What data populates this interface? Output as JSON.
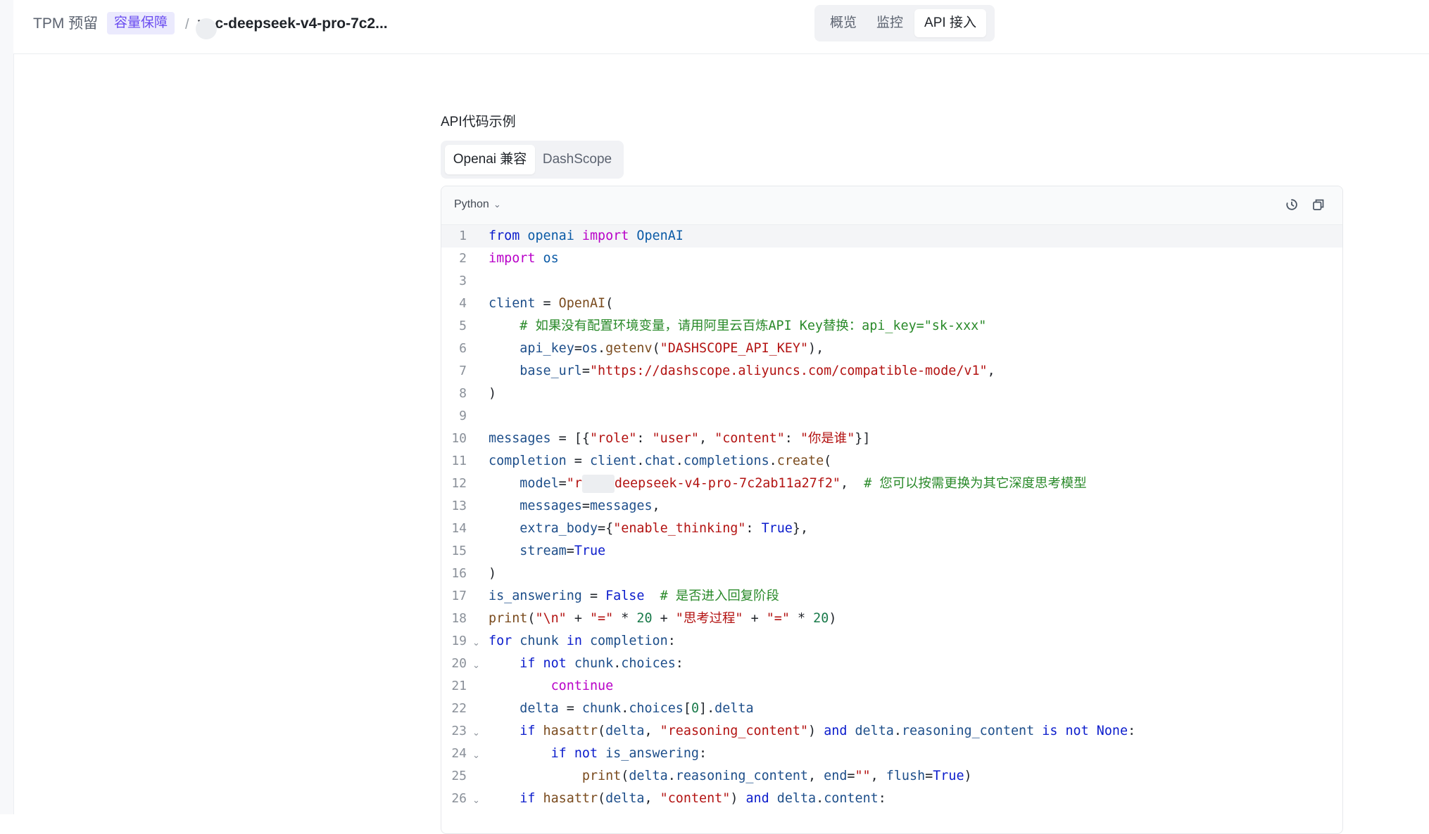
{
  "header": {
    "brand": "TPM 预留",
    "tag": "容量保障",
    "separator": "/",
    "breadcrumb": "v -c-deepseek-v4-pro-7c2...",
    "tabs": [
      {
        "label": "概览",
        "active": false
      },
      {
        "label": "监控",
        "active": false
      },
      {
        "label": "API 接入",
        "active": true
      }
    ]
  },
  "main": {
    "section_title": "API代码示例",
    "sdk_tabs": [
      {
        "label": "Openai 兼容",
        "active": true
      },
      {
        "label": "DashScope",
        "active": false
      }
    ],
    "code": {
      "language": "Python",
      "icons": [
        "history-icon",
        "copy-icon"
      ],
      "highlighted_line": 1,
      "lines": [
        {
          "n": "1",
          "fold": "",
          "tokens": [
            [
              "kw",
              "from"
            ],
            [
              "pl",
              " "
            ],
            [
              "cls",
              "openai"
            ],
            [
              "pl",
              " "
            ],
            [
              "imp",
              "import"
            ],
            [
              "pl",
              " "
            ],
            [
              "cls",
              "OpenAI"
            ]
          ]
        },
        {
          "n": "2",
          "fold": "",
          "tokens": [
            [
              "imp",
              "import"
            ],
            [
              "pl",
              " "
            ],
            [
              "cls",
              "os"
            ]
          ]
        },
        {
          "n": "3",
          "fold": "",
          "tokens": []
        },
        {
          "n": "4",
          "fold": "",
          "tokens": [
            [
              "id",
              "client"
            ],
            [
              "pl",
              " = "
            ],
            [
              "fn",
              "OpenAI"
            ],
            [
              "pl",
              "("
            ]
          ]
        },
        {
          "n": "5",
          "fold": "",
          "tokens": [
            [
              "pl",
              "    "
            ],
            [
              "cm",
              "# 如果没有配置环境变量，请用阿里云百炼API Key替换：api_key=\"sk-xxx\""
            ]
          ]
        },
        {
          "n": "6",
          "fold": "",
          "tokens": [
            [
              "pl",
              "    "
            ],
            [
              "id",
              "api_key"
            ],
            [
              "pl",
              "="
            ],
            [
              "id",
              "os"
            ],
            [
              "pl",
              "."
            ],
            [
              "fn",
              "getenv"
            ],
            [
              "pl",
              "("
            ],
            [
              "str",
              "\"DASHSCOPE_API_KEY\""
            ],
            [
              "pl",
              "),"
            ]
          ]
        },
        {
          "n": "7",
          "fold": "",
          "tokens": [
            [
              "pl",
              "    "
            ],
            [
              "id",
              "base_url"
            ],
            [
              "pl",
              "="
            ],
            [
              "str",
              "\"https://dashscope.aliyuncs.com/compatible-mode/v1\""
            ],
            [
              "pl",
              ","
            ]
          ]
        },
        {
          "n": "8",
          "fold": "",
          "tokens": [
            [
              "pl",
              ")"
            ]
          ]
        },
        {
          "n": "9",
          "fold": "",
          "tokens": []
        },
        {
          "n": "10",
          "fold": "",
          "tokens": [
            [
              "id",
              "messages"
            ],
            [
              "pl",
              " = [{"
            ],
            [
              "str",
              "\"role\""
            ],
            [
              "pl",
              ": "
            ],
            [
              "str",
              "\"user\""
            ],
            [
              "pl",
              ", "
            ],
            [
              "str",
              "\"content\""
            ],
            [
              "pl",
              ": "
            ],
            [
              "str",
              "\"你是谁\""
            ],
            [
              "pl",
              "}]"
            ]
          ]
        },
        {
          "n": "11",
          "fold": "",
          "tokens": [
            [
              "id",
              "completion"
            ],
            [
              "pl",
              " = "
            ],
            [
              "id",
              "client"
            ],
            [
              "pl",
              "."
            ],
            [
              "id",
              "chat"
            ],
            [
              "pl",
              "."
            ],
            [
              "id",
              "completions"
            ],
            [
              "pl",
              "."
            ],
            [
              "fn",
              "create"
            ],
            [
              "pl",
              "("
            ]
          ]
        },
        {
          "n": "12",
          "fold": "",
          "tokens": [
            [
              "pl",
              "    "
            ],
            [
              "id",
              "model"
            ],
            [
              "pl",
              "="
            ],
            [
              "str",
              "\"r"
            ],
            [
              "mask",
              ""
            ],
            [
              "str",
              "deepseek-v4-pro-7c2ab11a27f2\""
            ],
            [
              "pl",
              ",  "
            ],
            [
              "cm",
              "# 您可以按需更换为其它深度思考模型"
            ]
          ]
        },
        {
          "n": "13",
          "fold": "",
          "tokens": [
            [
              "pl",
              "    "
            ],
            [
              "id",
              "messages"
            ],
            [
              "pl",
              "="
            ],
            [
              "id",
              "messages"
            ],
            [
              "pl",
              ","
            ]
          ]
        },
        {
          "n": "14",
          "fold": "",
          "tokens": [
            [
              "pl",
              "    "
            ],
            [
              "id",
              "extra_body"
            ],
            [
              "pl",
              "={"
            ],
            [
              "str",
              "\"enable_thinking\""
            ],
            [
              "pl",
              ": "
            ],
            [
              "kw",
              "True"
            ],
            [
              "pl",
              "},"
            ]
          ]
        },
        {
          "n": "15",
          "fold": "",
          "tokens": [
            [
              "pl",
              "    "
            ],
            [
              "id",
              "stream"
            ],
            [
              "pl",
              "="
            ],
            [
              "kw",
              "True"
            ]
          ]
        },
        {
          "n": "16",
          "fold": "",
          "tokens": [
            [
              "pl",
              ")"
            ]
          ]
        },
        {
          "n": "17",
          "fold": "",
          "tokens": [
            [
              "id",
              "is_answering"
            ],
            [
              "pl",
              " = "
            ],
            [
              "kw",
              "False"
            ],
            [
              "pl",
              "  "
            ],
            [
              "cm",
              "# 是否进入回复阶段"
            ]
          ]
        },
        {
          "n": "18",
          "fold": "",
          "tokens": [
            [
              "fn",
              "print"
            ],
            [
              "pl",
              "("
            ],
            [
              "str",
              "\"\\n\""
            ],
            [
              "pl",
              " + "
            ],
            [
              "str",
              "\"=\""
            ],
            [
              "pl",
              " * "
            ],
            [
              "num",
              "20"
            ],
            [
              "pl",
              " + "
            ],
            [
              "str",
              "\"思考过程\""
            ],
            [
              "pl",
              " + "
            ],
            [
              "str",
              "\"=\""
            ],
            [
              "pl",
              " * "
            ],
            [
              "num",
              "20"
            ],
            [
              "pl",
              ")"
            ]
          ]
        },
        {
          "n": "19",
          "fold": "⌄",
          "tokens": [
            [
              "kw",
              "for"
            ],
            [
              "pl",
              " "
            ],
            [
              "id",
              "chunk"
            ],
            [
              "pl",
              " "
            ],
            [
              "kw",
              "in"
            ],
            [
              "pl",
              " "
            ],
            [
              "id",
              "completion"
            ],
            [
              "pl",
              ":"
            ]
          ]
        },
        {
          "n": "20",
          "fold": "⌄",
          "tokens": [
            [
              "pl",
              "    "
            ],
            [
              "kw",
              "if"
            ],
            [
              "pl",
              " "
            ],
            [
              "kw",
              "not"
            ],
            [
              "pl",
              " "
            ],
            [
              "id",
              "chunk"
            ],
            [
              "pl",
              "."
            ],
            [
              "id",
              "choices"
            ],
            [
              "pl",
              ":"
            ]
          ]
        },
        {
          "n": "21",
          "fold": "",
          "tokens": [
            [
              "pl",
              "        "
            ],
            [
              "imp",
              "continue"
            ]
          ]
        },
        {
          "n": "22",
          "fold": "",
          "tokens": [
            [
              "pl",
              "    "
            ],
            [
              "id",
              "delta"
            ],
            [
              "pl",
              " = "
            ],
            [
              "id",
              "chunk"
            ],
            [
              "pl",
              "."
            ],
            [
              "id",
              "choices"
            ],
            [
              "pl",
              "["
            ],
            [
              "num",
              "0"
            ],
            [
              "pl",
              "]."
            ],
            [
              "id",
              "delta"
            ]
          ]
        },
        {
          "n": "23",
          "fold": "⌄",
          "tokens": [
            [
              "pl",
              "    "
            ],
            [
              "kw",
              "if"
            ],
            [
              "pl",
              " "
            ],
            [
              "fn",
              "hasattr"
            ],
            [
              "pl",
              "("
            ],
            [
              "id",
              "delta"
            ],
            [
              "pl",
              ", "
            ],
            [
              "str",
              "\"reasoning_content\""
            ],
            [
              "pl",
              ") "
            ],
            [
              "kw",
              "and"
            ],
            [
              "pl",
              " "
            ],
            [
              "id",
              "delta"
            ],
            [
              "pl",
              "."
            ],
            [
              "id",
              "reasoning_content"
            ],
            [
              "pl",
              " "
            ],
            [
              "kw",
              "is"
            ],
            [
              "pl",
              " "
            ],
            [
              "kw",
              "not"
            ],
            [
              "pl",
              " "
            ],
            [
              "kw",
              "None"
            ],
            [
              "pl",
              ":"
            ]
          ]
        },
        {
          "n": "24",
          "fold": "⌄",
          "tokens": [
            [
              "pl",
              "        "
            ],
            [
              "kw",
              "if"
            ],
            [
              "pl",
              " "
            ],
            [
              "kw",
              "not"
            ],
            [
              "pl",
              " "
            ],
            [
              "id",
              "is_answering"
            ],
            [
              "pl",
              ":"
            ]
          ]
        },
        {
          "n": "25",
          "fold": "",
          "tokens": [
            [
              "pl",
              "            "
            ],
            [
              "fn",
              "print"
            ],
            [
              "pl",
              "("
            ],
            [
              "id",
              "delta"
            ],
            [
              "pl",
              "."
            ],
            [
              "id",
              "reasoning_content"
            ],
            [
              "pl",
              ", "
            ],
            [
              "id",
              "end"
            ],
            [
              "pl",
              "="
            ],
            [
              "str",
              "\"\""
            ],
            [
              "pl",
              ", "
            ],
            [
              "id",
              "flush"
            ],
            [
              "pl",
              "="
            ],
            [
              "kw",
              "True"
            ],
            [
              "pl",
              ")"
            ]
          ]
        },
        {
          "n": "26",
          "fold": "⌄",
          "tokens": [
            [
              "pl",
              "    "
            ],
            [
              "kw",
              "if"
            ],
            [
              "pl",
              " "
            ],
            [
              "fn",
              "hasattr"
            ],
            [
              "pl",
              "("
            ],
            [
              "id",
              "delta"
            ],
            [
              "pl",
              ", "
            ],
            [
              "str",
              "\"content\""
            ],
            [
              "pl",
              ") "
            ],
            [
              "kw",
              "and"
            ],
            [
              "pl",
              " "
            ],
            [
              "id",
              "delta"
            ],
            [
              "pl",
              "."
            ],
            [
              "id",
              "content"
            ],
            [
              "pl",
              ":"
            ]
          ]
        }
      ]
    }
  }
}
